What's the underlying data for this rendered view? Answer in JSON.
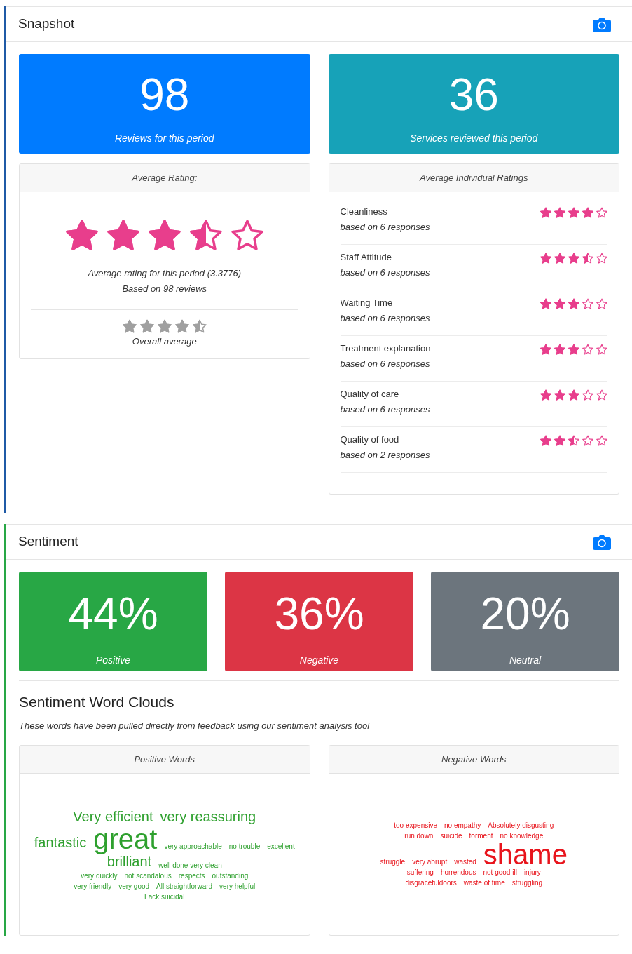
{
  "snapshot": {
    "title": "Snapshot",
    "stats": [
      {
        "value": "98",
        "label": "Reviews for this period",
        "color": "#007bff"
      },
      {
        "value": "36",
        "label": "Services reviewed this period",
        "color": "#17a2b8"
      }
    ],
    "average_rating": {
      "header": "Average Rating:",
      "stars": 3.5,
      "caption": "Average rating for this period (3.3776)",
      "based_on": "Based on 98 reviews",
      "overall": {
        "stars": 4.5,
        "label": "Overall average"
      }
    },
    "individual_ratings": {
      "header": "Average Individual Ratings",
      "rows": [
        {
          "name": "Cleanliness",
          "responses": "based on 6 responses",
          "stars": 4
        },
        {
          "name": "Staff Attitude",
          "responses": "based on 6 responses",
          "stars": 3.5
        },
        {
          "name": "Waiting Time",
          "responses": "based on 6 responses",
          "stars": 3
        },
        {
          "name": "Treatment explanation",
          "responses": "based on 6 responses",
          "stars": 3
        },
        {
          "name": "Quality of care",
          "responses": "based on 6 responses",
          "stars": 3
        },
        {
          "name": "Quality of food",
          "responses": "based on 2 responses",
          "stars": 2.5
        }
      ]
    }
  },
  "sentiment": {
    "title": "Sentiment",
    "stats": [
      {
        "value": "44%",
        "label": "Positive",
        "color": "#28a745"
      },
      {
        "value": "36%",
        "label": "Negative",
        "color": "#dc3545"
      },
      {
        "value": "20%",
        "label": "Neutral",
        "color": "#6c757d"
      }
    ],
    "clouds_title": "Sentiment Word Clouds",
    "clouds_subtitle": "These words have been pulled directly from feedback using our sentiment analysis tool",
    "clouds": [
      {
        "header": "Positive Words",
        "color": "#2ea02e",
        "lines": [
          [
            {
              "text": "Very efficient",
              "kind": "large"
            },
            {
              "text": "very reassuring",
              "kind": "large"
            }
          ],
          [
            {
              "text": "fantastic",
              "kind": "large"
            },
            {
              "text": "great",
              "kind": "huge"
            },
            {
              "text": "very approachable",
              "kind": "small"
            },
            {
              "text": "no trouble",
              "kind": "small"
            },
            {
              "text": "excellent",
              "kind": "small"
            }
          ],
          [
            {
              "text": "brilliant",
              "kind": "large"
            },
            {
              "text": "well done very clean",
              "kind": "small"
            }
          ],
          [
            {
              "text": "very quickly",
              "kind": "small"
            },
            {
              "text": "not scandalous",
              "kind": "small"
            },
            {
              "text": "respects",
              "kind": "small"
            },
            {
              "text": "outstanding",
              "kind": "small"
            }
          ],
          [
            {
              "text": "very friendly",
              "kind": "small"
            },
            {
              "text": "very good",
              "kind": "small"
            },
            {
              "text": "All straightforward",
              "kind": "small"
            },
            {
              "text": "very helpful",
              "kind": "small"
            }
          ],
          [
            {
              "text": "Lack suicidal",
              "kind": "small"
            }
          ]
        ]
      },
      {
        "header": "Negative Words",
        "color": "#e8141c",
        "lines": [
          [
            {
              "text": "too expensive",
              "kind": "small"
            },
            {
              "text": "no empathy",
              "kind": "small"
            },
            {
              "text": "Absolutely disgusting",
              "kind": "small"
            }
          ],
          [
            {
              "text": "run down",
              "kind": "small"
            },
            {
              "text": "suicide",
              "kind": "small"
            },
            {
              "text": "torment",
              "kind": "small"
            },
            {
              "text": "no knowledge",
              "kind": "small"
            }
          ],
          [
            {
              "text": "struggle",
              "kind": "small"
            },
            {
              "text": "very abrupt",
              "kind": "small"
            },
            {
              "text": "wasted",
              "kind": "small"
            },
            {
              "text": "shame",
              "kind": "huge"
            }
          ],
          [
            {
              "text": "suffering",
              "kind": "small"
            },
            {
              "text": "horrendous",
              "kind": "small"
            },
            {
              "text": "not good ill",
              "kind": "small"
            },
            {
              "text": "injury",
              "kind": "small"
            }
          ],
          [
            {
              "text": "disgracefuldoors",
              "kind": "small"
            },
            {
              "text": "waste of time",
              "kind": "small"
            },
            {
              "text": "struggling",
              "kind": "small"
            }
          ]
        ]
      }
    ]
  }
}
